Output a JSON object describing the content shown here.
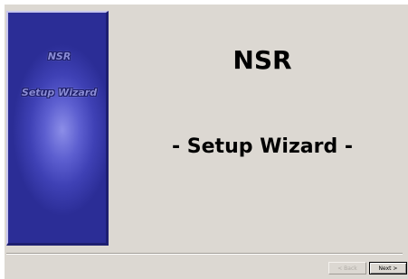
{
  "side_panel": {
    "line1": "NSR",
    "line2": "Setup Wizard"
  },
  "main": {
    "title": "NSR",
    "subtitle": "- Setup Wizard -"
  },
  "buttons": {
    "back_label": "< Back",
    "next_label": "Next >"
  },
  "colors": {
    "dialog_bg": "#dcd8d2",
    "panel_blue": "#3f41b5"
  }
}
